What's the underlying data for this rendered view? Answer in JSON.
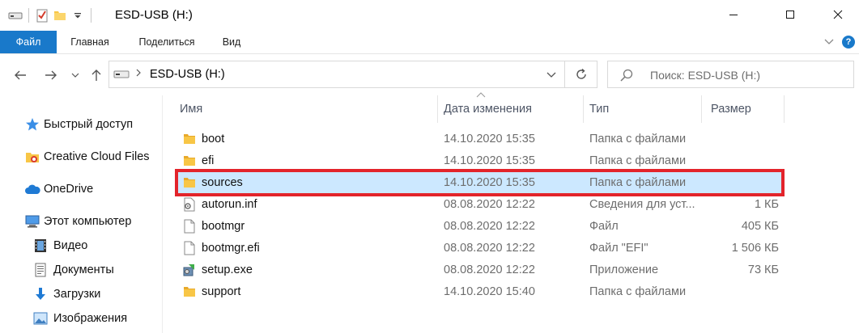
{
  "window": {
    "title": "ESD-USB (H:)",
    "controls": {
      "minimize": "minimize",
      "maximize": "maximize",
      "close": "close"
    }
  },
  "ribbon": {
    "tabs": [
      {
        "label": "Файл",
        "active": true
      },
      {
        "label": "Главная"
      },
      {
        "label": "Поделиться"
      },
      {
        "label": "Вид"
      }
    ],
    "help": "?"
  },
  "address": {
    "path": "ESD-USB (H:)",
    "search_placeholder": "Поиск: ESD-USB (H:)"
  },
  "nav_pane": {
    "items": [
      {
        "label": "Быстрый доступ",
        "icon": "star-icon"
      },
      {
        "label": "Creative Cloud Files",
        "icon": "creative-cloud-icon"
      },
      {
        "label": "OneDrive",
        "icon": "cloud-icon"
      },
      {
        "label": "Этот компьютер",
        "icon": "computer-icon"
      },
      {
        "label": "Видео",
        "icon": "video-icon"
      },
      {
        "label": "Документы",
        "icon": "documents-icon"
      },
      {
        "label": "Загрузки",
        "icon": "downloads-icon"
      },
      {
        "label": "Изображения",
        "icon": "pictures-icon"
      }
    ]
  },
  "columns": {
    "name": "Имя",
    "date": "Дата изменения",
    "type": "Тип",
    "size": "Размер"
  },
  "files": [
    {
      "name": "boot",
      "date": "14.10.2020 15:35",
      "type": "Папка с файлами",
      "size": "",
      "icon": "folder-icon"
    },
    {
      "name": "efi",
      "date": "14.10.2020 15:35",
      "type": "Папка с файлами",
      "size": "",
      "icon": "folder-icon"
    },
    {
      "name": "sources",
      "date": "14.10.2020 15:35",
      "type": "Папка с файлами",
      "size": "",
      "icon": "folder-icon",
      "selected": true
    },
    {
      "name": "autorun.inf",
      "date": "08.08.2020 12:22",
      "type": "Сведения для уст...",
      "size": "1 КБ",
      "icon": "setup-info-icon"
    },
    {
      "name": "bootmgr",
      "date": "08.08.2020 12:22",
      "type": "Файл",
      "size": "405 КБ",
      "icon": "file-icon"
    },
    {
      "name": "bootmgr.efi",
      "date": "08.08.2020 12:22",
      "type": "Файл \"EFI\"",
      "size": "1 506 КБ",
      "icon": "file-icon"
    },
    {
      "name": "setup.exe",
      "date": "08.08.2020 12:22",
      "type": "Приложение",
      "size": "73 КБ",
      "icon": "setup-exe-icon"
    },
    {
      "name": "support",
      "date": "14.10.2020 15:40",
      "type": "Папка с файлами",
      "size": "",
      "icon": "folder-icon"
    }
  ],
  "colors": {
    "accent": "#1979ca",
    "selection": "#cce8ff",
    "highlight_border": "#e3242b",
    "folder": "#f8c646"
  }
}
